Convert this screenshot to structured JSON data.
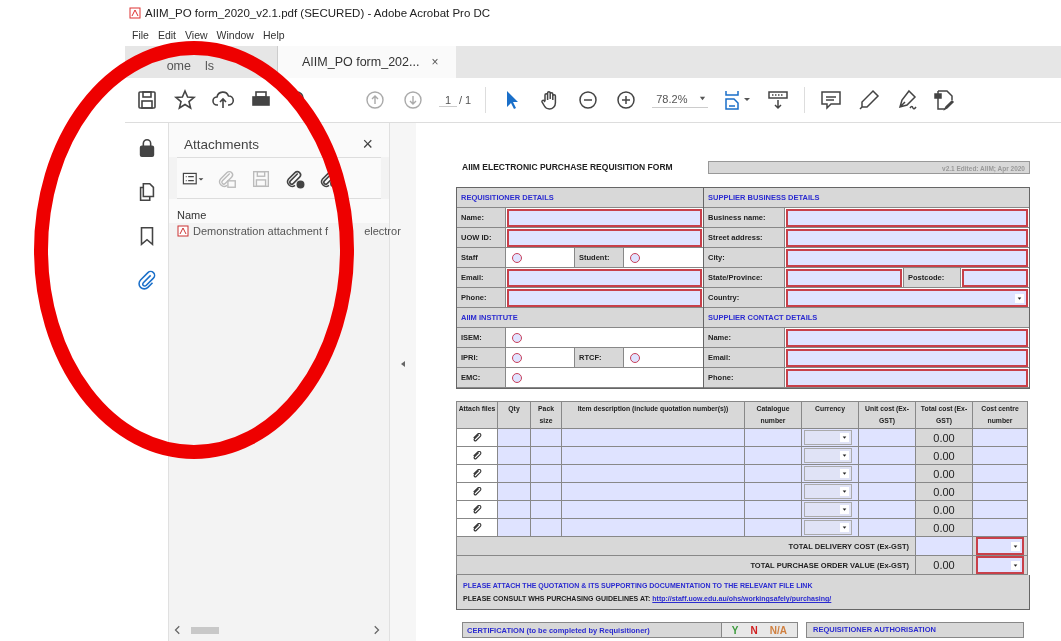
{
  "window": {
    "title": "AIIM_PO form_2020_v2.1.pdf (SECURED) - Adobe Acrobat Pro DC"
  },
  "menu": [
    "File",
    "Edit",
    "View",
    "Window",
    "Help"
  ],
  "tabs": [
    {
      "label": "ome",
      "selected": false
    },
    {
      "label": "ls",
      "selected": false
    },
    {
      "label": "AIIM_PO form_202...",
      "selected": true,
      "close": "×"
    }
  ],
  "toolbar": {
    "page": "1",
    "page_total": "/ 1",
    "zoom": "78.2%"
  },
  "rail": [
    {
      "kind": "lock",
      "selected": false
    },
    {
      "kind": "pages",
      "selected": false
    },
    {
      "kind": "bookmark",
      "selected": false
    },
    {
      "kind": "attachment",
      "selected": true
    }
  ],
  "attachments": {
    "title": "Attachments",
    "close": "×",
    "column": "Name",
    "items": [
      {
        "name": "Demonstration attachment f",
        "name_after_mark": "electror"
      }
    ]
  },
  "form": {
    "title": "AIIM ELECTRONIC PURCHASE REQUISITION FORM",
    "version": "v2.1 Edited: AIIM; Apr 2020",
    "columns": [
      [
        {
          "heading": "REQUISITIONER DETAILS",
          "rows": [
            [
              {
                "label": "Name:",
                "kind": "text"
              }
            ],
            [
              {
                "label": "UOW ID:",
                "kind": "text"
              }
            ],
            [
              {
                "label": "Staff",
                "kind": "radio",
                "checked": false
              },
              {
                "label": "Student:",
                "kind": "radio",
                "checked": false
              }
            ],
            [
              {
                "label": "Email:",
                "kind": "text"
              }
            ],
            [
              {
                "label": "Phone:",
                "kind": "text"
              }
            ]
          ]
        },
        {
          "heading": "AIIM INSTITUTE",
          "rows": [
            [
              {
                "label": "ISEM:",
                "kind": "radio",
                "checked": false
              }
            ],
            [
              {
                "label": "IPRI:",
                "kind": "radio",
                "checked": false
              },
              {
                "label": "RTCF:",
                "kind": "radio",
                "checked": false
              }
            ],
            [
              {
                "label": "EMC:",
                "kind": "radio",
                "checked": false
              }
            ]
          ]
        }
      ],
      [
        {
          "heading": "SUPPLIER BUSINESS DETAILS",
          "rows": [
            [
              {
                "label": "Business name:",
                "kind": "text"
              }
            ],
            [
              {
                "label": "Street address:",
                "kind": "text"
              }
            ],
            [
              {
                "label": "City:",
                "kind": "text"
              }
            ],
            [
              {
                "label": "State/Province:",
                "kind": "text"
              },
              {
                "label": "Postcode:",
                "kind": "text"
              }
            ],
            [
              {
                "label": "Country:",
                "kind": "dropdown"
              }
            ]
          ]
        },
        {
          "heading": "SUPPLIER CONTACT DETAILS",
          "rows": [
            [
              {
                "label": "Name:",
                "kind": "text"
              }
            ],
            [
              {
                "label": "Email:",
                "kind": "text"
              }
            ],
            [
              {
                "label": "Phone:",
                "kind": "text"
              }
            ]
          ]
        }
      ]
    ],
    "item_columns": [
      "Attach files",
      "Qty",
      "Pack size",
      "Item description (include quotation number(s))",
      "Catalogue number",
      "Currency",
      "Unit cost (Ex-GST)",
      "Total cost (Ex-GST)",
      "Cost centre number"
    ],
    "items": [
      {
        "total": "0.00"
      },
      {
        "total": "0.00"
      },
      {
        "total": "0.00"
      },
      {
        "total": "0.00"
      },
      {
        "total": "0.00"
      },
      {
        "total": "0.00"
      }
    ],
    "totals": [
      {
        "label": "TOTAL DELIVERY COST (Ex-GST)"
      },
      {
        "label": "TOTAL PURCHASE ORDER VALUE (Ex-GST)",
        "value": "0.00"
      }
    ],
    "notice": "PLEASE ATTACH THE QUOTATION & ITS SUPPORTING DOCUMENTATION TO THE RELEVANT FILE LINK",
    "guidelines": "PLEASE CONSULT WHS PURCHASING GUIDELINES AT:",
    "guidelines_link": "http://staff.uow.edu.au/ohs/workingsafely/purchasing/",
    "certification": {
      "title": "CERTIFICATION (to be completed by Requisitioner)",
      "options": [
        {
          "label": "Y",
          "color": "#3a9a3a"
        },
        {
          "label": "N",
          "color": "#d02020"
        },
        {
          "label": "N/A",
          "color": "#d08040"
        }
      ]
    },
    "authorisation": "REQUISITIONER AUTHORISATION"
  }
}
